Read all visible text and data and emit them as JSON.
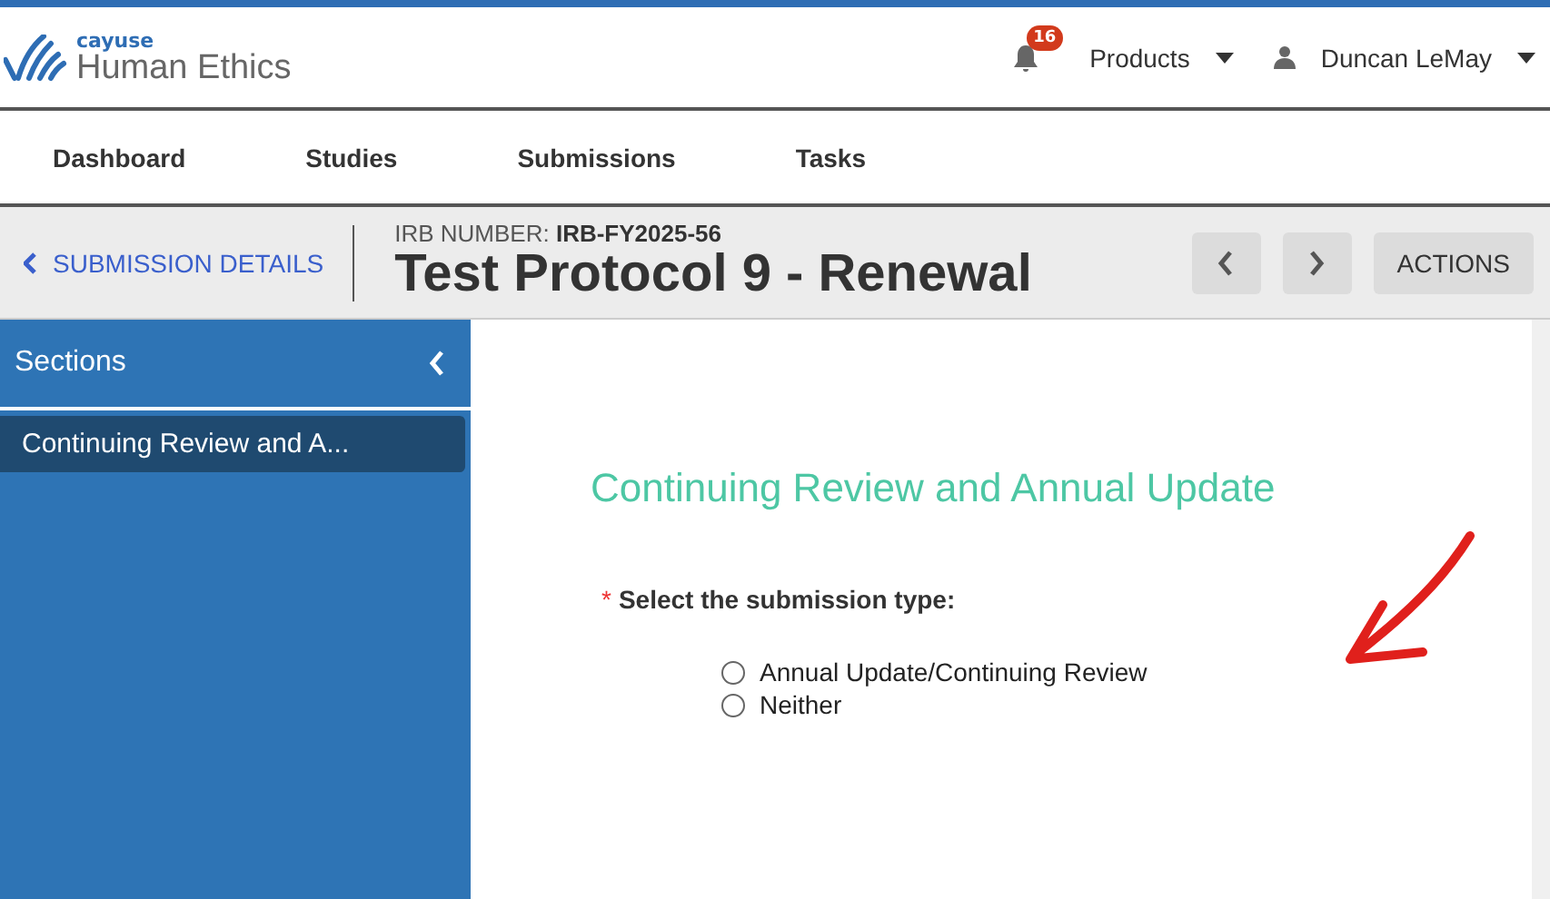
{
  "logo": {
    "brand": "cayuse",
    "product": "Human Ethics"
  },
  "header": {
    "notifications": "16",
    "products": "Products",
    "user": "Duncan LeMay"
  },
  "nav": [
    {
      "label": "Dashboard"
    },
    {
      "label": "Studies"
    },
    {
      "label": "Submissions"
    },
    {
      "label": "Tasks"
    }
  ],
  "subheader": {
    "back": "SUBMISSION DETAILS",
    "irb_label": "IRB NUMBER:",
    "irb_number": "IRB-FY2025-56",
    "title": "Test Protocol 9 - Renewal",
    "actions": "ACTIONS"
  },
  "sidebar": {
    "title": "Sections",
    "items": [
      {
        "label": "Continuing Review and A...",
        "selected": true
      }
    ]
  },
  "form": {
    "heading": "Continuing Review and Annual Update",
    "required_mark": "*",
    "question": "Select the submission type:",
    "options": [
      {
        "label": "Annual Update/Continuing Review",
        "selected": false
      },
      {
        "label": "Neither",
        "selected": false
      }
    ]
  }
}
